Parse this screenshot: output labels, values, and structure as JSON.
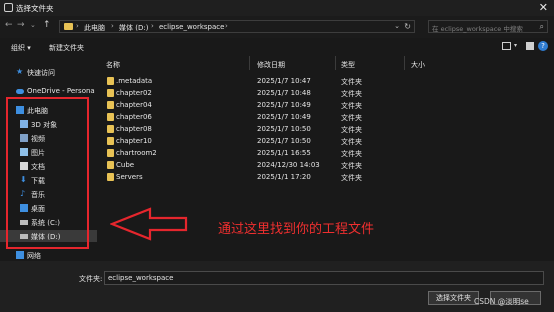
{
  "window": {
    "title": "选择文件夹",
    "close_glyph": "✕"
  },
  "address_bar": {
    "crumbs": [
      "此电脑",
      "媒体 (D:)",
      "eclipse_workspace"
    ],
    "search_placeholder": "在 eclipse_workspace 中搜索"
  },
  "toolbar": {
    "organize_label": "组织 ▾",
    "new_folder_label": "新建文件夹"
  },
  "nav": {
    "quick_access": "快速访问",
    "onedrive": "OneDrive - Persona",
    "this_pc": "此电脑",
    "items": [
      "3D 对象",
      "视频",
      "图片",
      "文档",
      "下载",
      "音乐",
      "桌面",
      "系统 (C:)",
      "媒体 (D:)"
    ],
    "network": "网络"
  },
  "table": {
    "headers": [
      "名称",
      "修改日期",
      "类型",
      "大小"
    ],
    "rows": [
      {
        "name": ".metadata",
        "date": "2025/1/7 10:47",
        "type": "文件夹"
      },
      {
        "name": "chapter02",
        "date": "2025/1/7 10:48",
        "type": "文件夹"
      },
      {
        "name": "chapter04",
        "date": "2025/1/7 10:49",
        "type": "文件夹"
      },
      {
        "name": "chapter06",
        "date": "2025/1/7 10:49",
        "type": "文件夹"
      },
      {
        "name": "chapter08",
        "date": "2025/1/7 10:50",
        "type": "文件夹"
      },
      {
        "name": "chapter10",
        "date": "2025/1/7 10:50",
        "type": "文件夹"
      },
      {
        "name": "chartroom2",
        "date": "2025/1/1 16:55",
        "type": "文件夹"
      },
      {
        "name": "Cube",
        "date": "2024/12/30 14:03",
        "type": "文件夹"
      },
      {
        "name": "Servers",
        "date": "2025/1/1 17:20",
        "type": "文件夹"
      }
    ]
  },
  "annotation": {
    "text": "通过这里找到你的工程文件",
    "color": "#ef2f2f"
  },
  "footer": {
    "filename_label": "文件夹:",
    "filename_value": "eclipse_workspace",
    "select_button": "选择文件夹",
    "watermark": "CSDN @淡明se"
  },
  "colors": {
    "background": "#191919",
    "folder": "#e8c255",
    "accent": "#3e8fe0",
    "highlight": "#e5262d"
  }
}
